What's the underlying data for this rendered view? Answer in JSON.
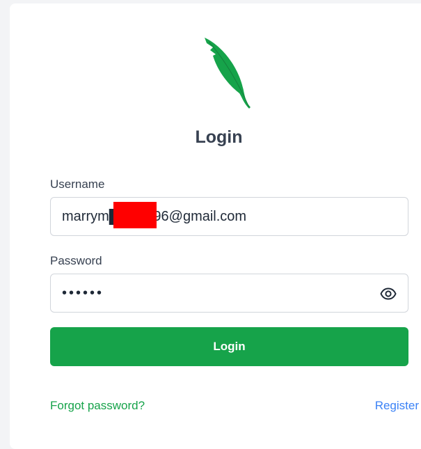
{
  "app": {
    "title": "Login",
    "brand_color": "#16a34a",
    "logo_icon": "feather-icon"
  },
  "form": {
    "username_label": "Username",
    "username_value": "marrym███y196@gmail.com",
    "password_label": "Password",
    "password_value": "••••••",
    "password_toggle_icon": "eye-icon",
    "submit_label": "Login"
  },
  "links": {
    "forgot_password": "Forgot password?",
    "register": "Register",
    "link_color": "#3b82f6"
  }
}
